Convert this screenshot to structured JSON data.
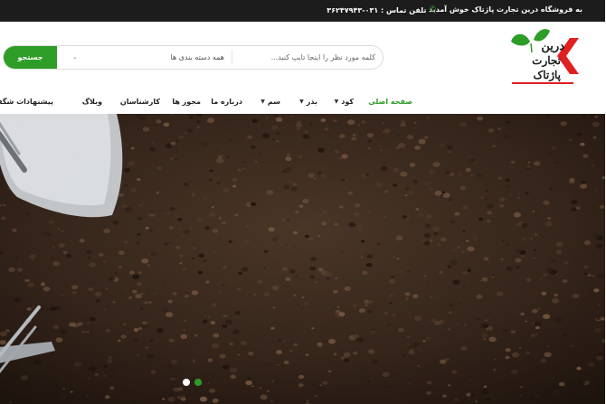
{
  "topbar": {
    "welcome": "به فروشگاه درین تجارت پاژتاک خوش آمدید",
    "phone_label": "تلفن تماس : ۰۳۱-۳۶۲۴۷۹۴۳",
    "phone_icon": "phone-icon"
  },
  "logo": {
    "line1": "درین",
    "line2": "تجارت",
    "line3": "پاژتاک",
    "accent_color": "#e02020",
    "leaf_color": "#2e9d27"
  },
  "search": {
    "placeholder": "کلمه مورد نظر را اینجا تایپ کنید...",
    "category_selected": "همه دسته بندی ها",
    "button_label": "جستجو"
  },
  "nav": {
    "items": [
      {
        "label": "صفحه اصلی"
      },
      {
        "label": "کود"
      },
      {
        "label": "بذر"
      },
      {
        "label": "سم"
      },
      {
        "label": "درباره ما"
      },
      {
        "label": "مجوز ها"
      },
      {
        "label": "کارشناسان"
      },
      {
        "label": "وبلاگ"
      },
      {
        "label": "پیشنهادات شگفت انگیز"
      }
    ]
  },
  "theme": {
    "brand_green": "#2e9d27",
    "topbar_bg": "#1c1c1c",
    "soil_color": "#3b2a1f"
  },
  "slider": {
    "total_slides": 2,
    "active_slide": 2
  }
}
